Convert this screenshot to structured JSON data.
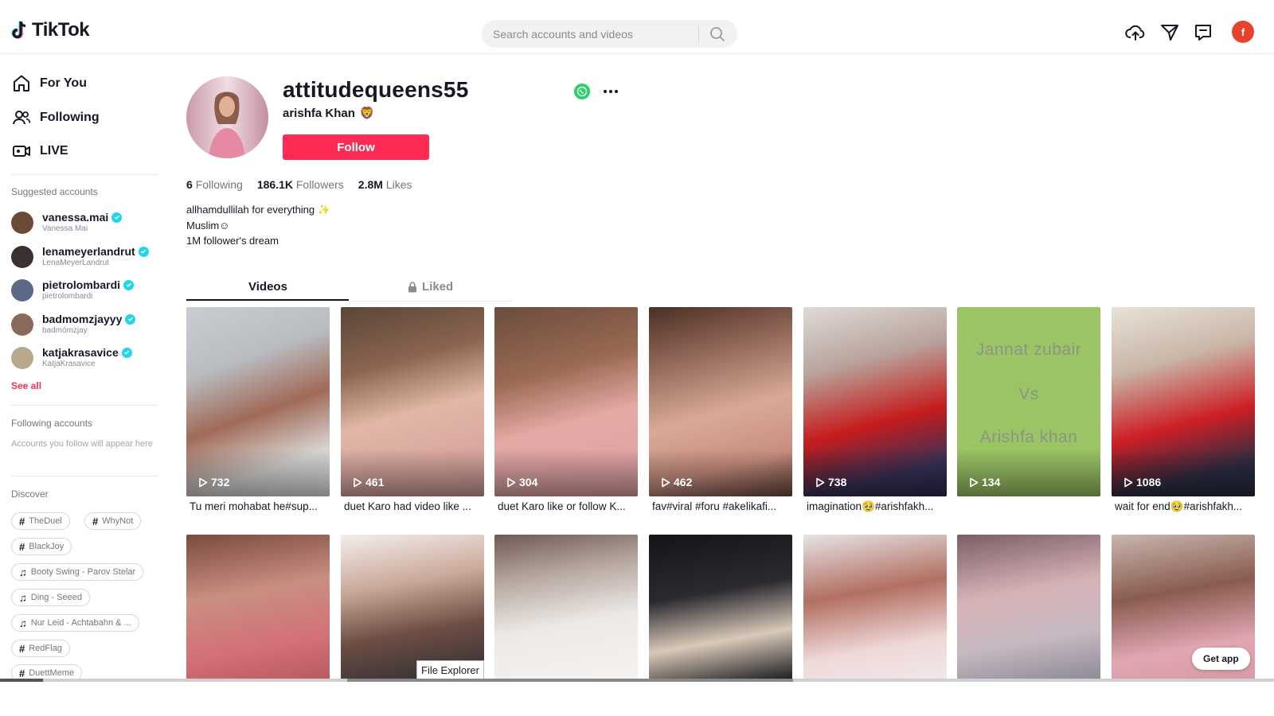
{
  "app": {
    "logo_text": "TikTok"
  },
  "header": {
    "search_placeholder": "Search accounts and videos",
    "user_initial": "f"
  },
  "nav": [
    {
      "label": "For You",
      "icon": "home-icon"
    },
    {
      "label": "Following",
      "icon": "users-icon"
    },
    {
      "label": "LIVE",
      "icon": "live-icon"
    }
  ],
  "suggested": {
    "title": "Suggested accounts",
    "see_all": "See all",
    "accounts": [
      {
        "username": "vanessa.mai",
        "name": "Vanessa Mai",
        "color": "#6b4a3a"
      },
      {
        "username": "lenameyerlandrut",
        "name": "LenaMeyerLandrut",
        "color": "#3a3230"
      },
      {
        "username": "pietrolombardi",
        "name": "pietrolombardi",
        "color": "#5b6a86"
      },
      {
        "username": "badmomzjayyy",
        "name": "badmómzjay",
        "color": "#8a6a5c"
      },
      {
        "username": "katjakrasavice",
        "name": "KatjaKrasavice",
        "color": "#b8a98d"
      }
    ]
  },
  "following_accounts": {
    "title": "Following accounts",
    "note": "Accounts you follow will appear here"
  },
  "discover": {
    "title": "Discover",
    "tags": [
      {
        "type": "hashtag",
        "label": "TheDuel"
      },
      {
        "type": "hashtag",
        "label": "WhyNot"
      },
      {
        "type": "hashtag",
        "label": "BlackJoy"
      },
      {
        "type": "music",
        "label": "Booty Swing - Parov Stelar"
      },
      {
        "type": "music",
        "label": "Ding - Seeed"
      },
      {
        "type": "music",
        "label": "Nur Leid - Achtabahn & ..."
      },
      {
        "type": "hashtag",
        "label": "RedFlag"
      },
      {
        "type": "hashtag",
        "label": "DuettMeme"
      }
    ]
  },
  "profile": {
    "username": "attitudequeens55",
    "display_name": "arishfa Khan",
    "name_emoji": "🦁",
    "follow_label": "Follow",
    "stats": [
      {
        "value": "6",
        "label": "Following"
      },
      {
        "value": "186.1K",
        "label": "Followers"
      },
      {
        "value": "2.8M",
        "label": "Likes"
      }
    ],
    "bio": [
      "allhamdullilah for everything ✨",
      "Muslim☺",
      "1M follower's dream"
    ]
  },
  "tabs": {
    "videos": "Videos",
    "liked": "Liked"
  },
  "videos_row1": [
    {
      "views": "732",
      "caption": "Tu meri mohabat he#sup...",
      "bg": "linear-gradient(160deg,#c9cdd2 0%,#b9bcc0 30%,#a06a58 55%,#d8d6d4 80%,#e8e8e8 100%)"
    },
    {
      "views": "461",
      "caption": "duet Karo had video like ...",
      "bg": "linear-gradient(165deg,#5b4638 0%,#8a6450 30%,#e2b7a6 55%,#d9a6a0 80%,#cf9c98 100%)"
    },
    {
      "views": "304",
      "caption": "duet Karo like or follow K...",
      "bg": "linear-gradient(165deg,#6b4c3e 0%,#9a6a52 35%,#e4aaa6 60%,#dfa1a4 100%)"
    },
    {
      "views": "462",
      "caption": "fav#viral #foru #akelikafi...",
      "bg": "linear-gradient(165deg,#4a2f24 0%,#8e6456 25%,#d9aa96 55%,#c88e80 80%,#6c4a3e 100%)"
    },
    {
      "views": "738",
      "caption": "imagination🥹#arishfakh...",
      "bg": "linear-gradient(165deg,#e0dad8 0%,#b8a49c 30%,#c51c1c 60%,#35325a 85%,#2e2b4a 100%)"
    },
    {
      "views": "134",
      "caption": "",
      "bg": "#9bc465",
      "overlay": [
        "Jannat zubair",
        "Vs",
        "Arishfa khan"
      ]
    },
    {
      "views": "1086",
      "caption": "wait for end🥹#arishfakh...",
      "bg": "linear-gradient(165deg,#e8e2d8 0%,#c9b6a8 30%,#cc1f24 60%,#2a2e44 85%,#26293c 100%)"
    }
  ],
  "videos_row2": [
    {
      "bg": "linear-gradient(170deg,#7a4a3e 0%,#c98f82 40%,#d36f78 75%,#b85a63 100%)"
    },
    {
      "bg": "linear-gradient(170deg,#f3eeec 0%,#caa899 35%,#6e4e44 65%,#2f2f33 100%)"
    },
    {
      "bg": "linear-gradient(170deg,#6f5a52 0%,#b8aaa2 30%,#ece9e6 60%,#f5f3f1 100%)"
    },
    {
      "bg": "linear-gradient(170deg,#141418 0%,#2b2a30 40%,#d9c9b8 70%,#1c1c20 100%)"
    },
    {
      "bg": "linear-gradient(170deg,#e7e3e6 0%,#b27062 40%,#efd8d8 75%,#f1e8ea 100%)"
    },
    {
      "bg": "linear-gradient(170deg,#7a5e66 0%,#d6b2b6 40%,#c6b9c2 70%,#8e8a96 100%)"
    },
    {
      "bg": "linear-gradient(170deg,#c8b6ae 0%,#8a5c50 40%,#e0a6b2 75%,#d89aa8 100%)"
    }
  ],
  "overlays": {
    "tooltip": "File Explorer",
    "get_app": "Get app"
  }
}
